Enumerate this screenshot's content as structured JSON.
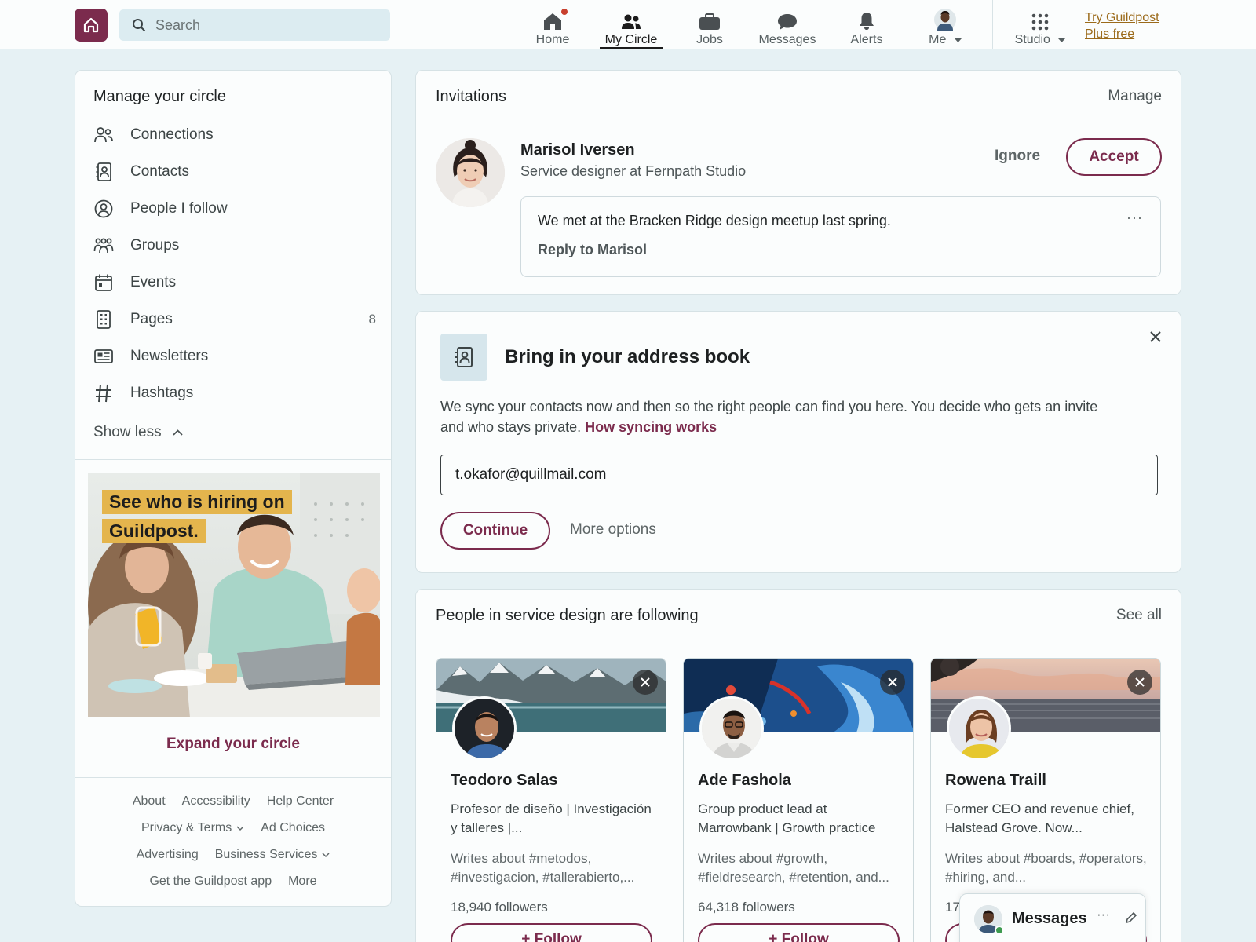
{
  "nav": {
    "search_placeholder": "Search",
    "items": [
      {
        "label": "Home",
        "icon": "home-icon"
      },
      {
        "label": "My Circle",
        "icon": "people-icon"
      },
      {
        "label": "Jobs",
        "icon": "briefcase-icon"
      },
      {
        "label": "Messages",
        "icon": "chat-icon"
      },
      {
        "label": "Alerts",
        "icon": "bell-icon"
      },
      {
        "label": "Me",
        "icon": "avatar-icon"
      },
      {
        "label": "Studio",
        "icon": "grid-icon"
      }
    ],
    "active": "My Circle",
    "try_line1": "Try Guildpost",
    "try_line2": "Plus free"
  },
  "sidebar": {
    "title": "Manage your circle",
    "items": [
      {
        "label": "Connections",
        "icon": "people-icon"
      },
      {
        "label": "Contacts",
        "icon": "contact-card-icon"
      },
      {
        "label": "People I follow",
        "icon": "person-circle-icon"
      },
      {
        "label": "Groups",
        "icon": "group-icon"
      },
      {
        "label": "Events",
        "icon": "calendar-icon"
      },
      {
        "label": "Pages",
        "icon": "page-icon",
        "count": "8"
      },
      {
        "label": "Newsletters",
        "icon": "newspaper-icon"
      },
      {
        "label": "Hashtags",
        "icon": "hashtag-icon"
      }
    ],
    "show_less": "Show less",
    "ad_line1": "See who is hiring on",
    "ad_line2": "Guildpost.",
    "expand": "Expand your circle",
    "footer": {
      "row1": [
        "About",
        "Accessibility",
        "Help Center"
      ],
      "row2": [
        "Privacy & Terms",
        "Ad Choices"
      ],
      "row3": [
        "Advertising",
        "Business Services"
      ],
      "row4": [
        "Get the Guildpost app",
        "More"
      ]
    }
  },
  "invitations": {
    "title": "Invitations",
    "manage": "Manage",
    "name": "Marisol Iversen",
    "headline": "Service designer at Fernpath Studio",
    "ignore": "Ignore",
    "accept": "Accept",
    "message": "We met at the Bracken Ridge design meetup last spring.",
    "reply": "Reply to Marisol",
    "more": "···"
  },
  "address_book": {
    "title": "Bring in your address book",
    "description": "We sync your contacts now and then so the right people can find you here. You decide who gets an invite and who stays private.",
    "link": "How syncing works",
    "email": "t.okafor@quillmail.com",
    "continue": "Continue",
    "more_options": "More options"
  },
  "people": {
    "title": "People in service design are following",
    "see_all": "See all",
    "follow": "Follow",
    "cards": [
      {
        "name": "Teodoro Salas",
        "headline": "Profesor de diseño | Investigación y talleres |...",
        "writes": "Writes about #metodos, #investigacion, #tallerabierto,...",
        "followers": "18,940 followers"
      },
      {
        "name": "Ade Fashola",
        "headline": "Group product lead at Marrowbank | Growth practice",
        "writes": "Writes about #growth, #fieldresearch, #retention, and...",
        "followers": "64,318 followers"
      },
      {
        "name": "Rowena Traill",
        "headline": "Former CEO and revenue chief, Halstead Grove. Now...",
        "writes": "Writes about #boards, #operators, #hiring, and...",
        "followers": "17"
      }
    ]
  },
  "dock": {
    "title": "Messages",
    "more": "···"
  },
  "colors": {
    "brand": "#7b2b4d",
    "accent_gold": "#e4b54d",
    "bg": "#e6f1f4"
  }
}
